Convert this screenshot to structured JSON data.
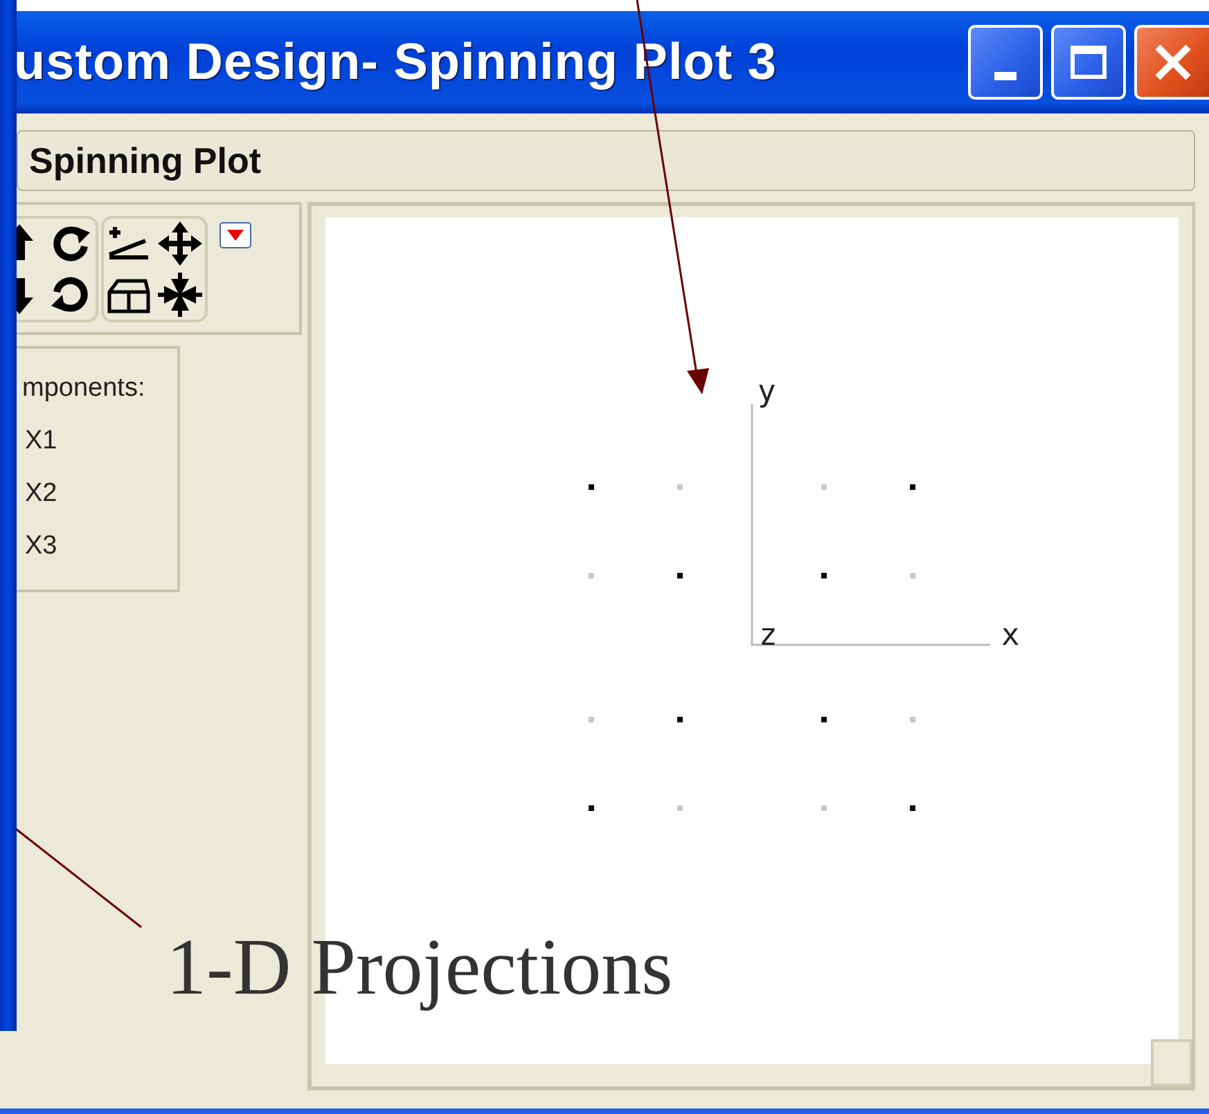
{
  "window": {
    "title": "ustom Design- Spinning Plot 3"
  },
  "outline": {
    "title": "Spinning Plot"
  },
  "components": {
    "label": "mponents:",
    "items": [
      "X1",
      "X2",
      "X3"
    ]
  },
  "plot": {
    "axes": [
      "x",
      "y",
      "z"
    ]
  },
  "annotation": {
    "text": "1-D Projections"
  }
}
